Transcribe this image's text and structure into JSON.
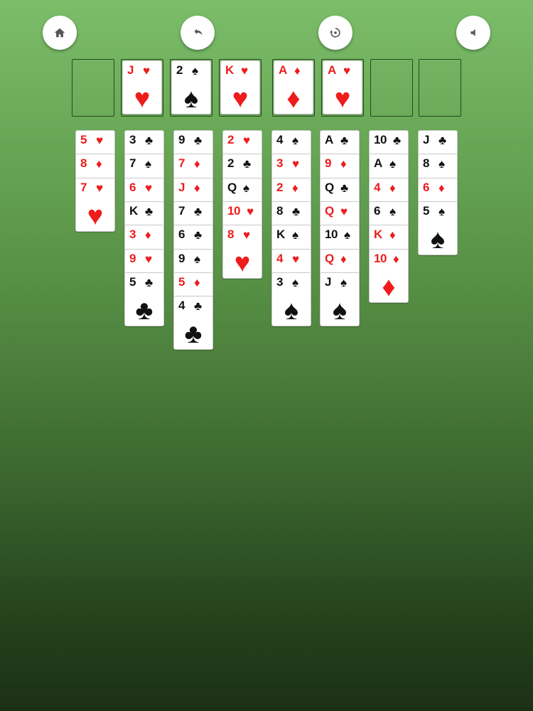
{
  "toolbar": {
    "home": "home-icon",
    "undo": "undo-icon",
    "restart": "restart-icon",
    "sound": "speaker-icon"
  },
  "free_cells": [
    null,
    {
      "rank": "J",
      "suit": "hearts"
    },
    {
      "rank": "2",
      "suit": "spades"
    },
    {
      "rank": "K",
      "suit": "hearts"
    }
  ],
  "foundations": [
    {
      "rank": "A",
      "suit": "diamonds"
    },
    {
      "rank": "A",
      "suit": "hearts"
    },
    null,
    null
  ],
  "tableau": [
    [
      {
        "rank": "5",
        "suit": "hearts"
      },
      {
        "rank": "8",
        "suit": "diamonds"
      },
      {
        "rank": "7",
        "suit": "hearts"
      }
    ],
    [
      {
        "rank": "3",
        "suit": "clubs"
      },
      {
        "rank": "7",
        "suit": "spades"
      },
      {
        "rank": "6",
        "suit": "hearts"
      },
      {
        "rank": "K",
        "suit": "clubs"
      },
      {
        "rank": "3",
        "suit": "diamonds"
      },
      {
        "rank": "9",
        "suit": "hearts"
      },
      {
        "rank": "5",
        "suit": "clubs"
      }
    ],
    [
      {
        "rank": "9",
        "suit": "clubs"
      },
      {
        "rank": "7",
        "suit": "diamonds"
      },
      {
        "rank": "J",
        "suit": "diamonds"
      },
      {
        "rank": "7",
        "suit": "clubs"
      },
      {
        "rank": "6",
        "suit": "clubs"
      },
      {
        "rank": "9",
        "suit": "spades"
      },
      {
        "rank": "5",
        "suit": "diamonds"
      },
      {
        "rank": "4",
        "suit": "clubs"
      }
    ],
    [
      {
        "rank": "2",
        "suit": "hearts"
      },
      {
        "rank": "2",
        "suit": "clubs"
      },
      {
        "rank": "Q",
        "suit": "spades"
      },
      {
        "rank": "10",
        "suit": "hearts"
      },
      {
        "rank": "8",
        "suit": "hearts"
      }
    ],
    [
      {
        "rank": "4",
        "suit": "spades"
      },
      {
        "rank": "3",
        "suit": "hearts"
      },
      {
        "rank": "2",
        "suit": "diamonds"
      },
      {
        "rank": "8",
        "suit": "clubs"
      },
      {
        "rank": "K",
        "suit": "spades"
      },
      {
        "rank": "4",
        "suit": "hearts"
      },
      {
        "rank": "3",
        "suit": "spades"
      }
    ],
    [
      {
        "rank": "A",
        "suit": "clubs"
      },
      {
        "rank": "9",
        "suit": "diamonds"
      },
      {
        "rank": "Q",
        "suit": "clubs"
      },
      {
        "rank": "Q",
        "suit": "hearts"
      },
      {
        "rank": "10",
        "suit": "spades"
      },
      {
        "rank": "Q",
        "suit": "diamonds"
      },
      {
        "rank": "J",
        "suit": "spades"
      }
    ],
    [
      {
        "rank": "10",
        "suit": "clubs"
      },
      {
        "rank": "A",
        "suit": "spades"
      },
      {
        "rank": "4",
        "suit": "diamonds"
      },
      {
        "rank": "6",
        "suit": "spades"
      },
      {
        "rank": "K",
        "suit": "diamonds"
      },
      {
        "rank": "10",
        "suit": "diamonds"
      }
    ],
    [
      {
        "rank": "J",
        "suit": "clubs"
      },
      {
        "rank": "8",
        "suit": "spades"
      },
      {
        "rank": "6",
        "suit": "diamonds"
      },
      {
        "rank": "5",
        "suit": "spades"
      }
    ]
  ],
  "colors": {
    "red_suit": "#ee1c1c",
    "black_suit": "#111111",
    "felt_top": "#7cbd6a",
    "felt_bottom": "#1c3016"
  }
}
